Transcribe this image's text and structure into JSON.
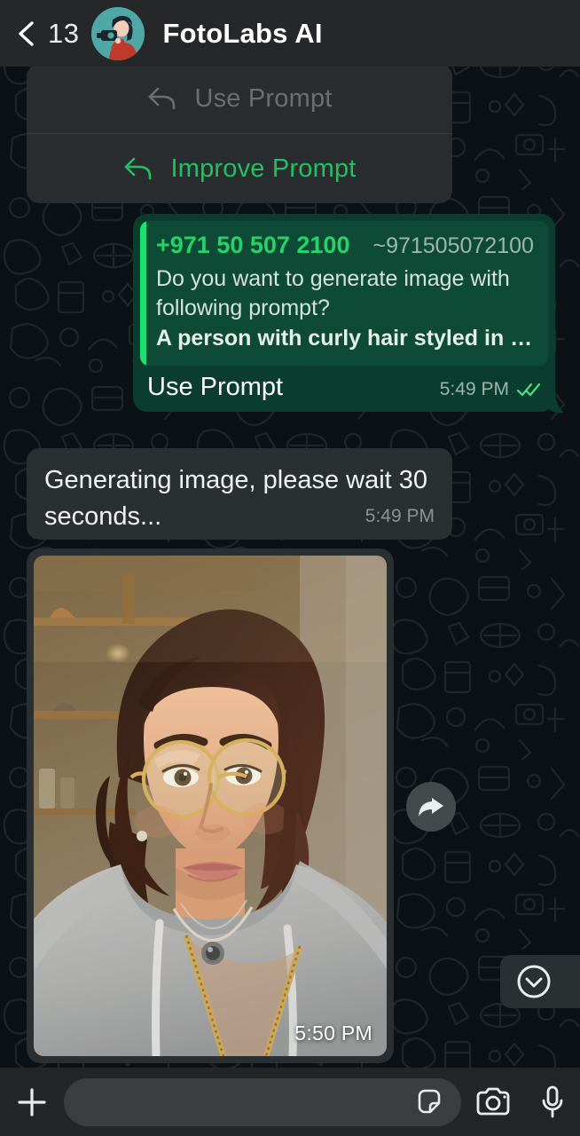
{
  "header": {
    "back_icon": "back-chevron-icon",
    "unread_count": "13",
    "avatar_icon": "photographer-avatar",
    "contact_name": "FotoLabs AI"
  },
  "prompt_menu": {
    "items": [
      {
        "label": "Use Prompt",
        "icon": "reply-arrow-icon",
        "state": "disabled"
      },
      {
        "label": "Improve Prompt",
        "icon": "reply-arrow-icon",
        "state": "active"
      }
    ]
  },
  "messages": {
    "outgoing": {
      "quote": {
        "author": "+971 50 507 2100",
        "handle": "~971505072100",
        "line1": "Do you want to generate image with",
        "line2": "following prompt?",
        "line3": "A person with curly hair styled in a care..."
      },
      "text": "Use Prompt",
      "time": "5:49 PM",
      "status_icon": "double-check-icon"
    },
    "incoming": {
      "text": "Generating image, please wait 30 seconds...",
      "time": "5:49 PM"
    },
    "image_message": {
      "time": "5:50 PM",
      "alt": "generated-portrait-photo"
    }
  },
  "actions": {
    "forward_icon": "forward-arrow-icon",
    "scroll_bottom_icon": "chevron-down-circle-icon"
  },
  "footer": {
    "attach_icon": "plus-icon",
    "input_value": "",
    "input_placeholder": "",
    "sticker_icon": "sticker-icon",
    "camera_icon": "camera-icon",
    "mic_icon": "microphone-icon"
  },
  "colors": {
    "accent_green": "#21C063",
    "bubble_out": "#0B3D2E",
    "bubble_in": "#2A2F32",
    "header_bg": "#262728",
    "chat_bg": "#0B1114"
  }
}
